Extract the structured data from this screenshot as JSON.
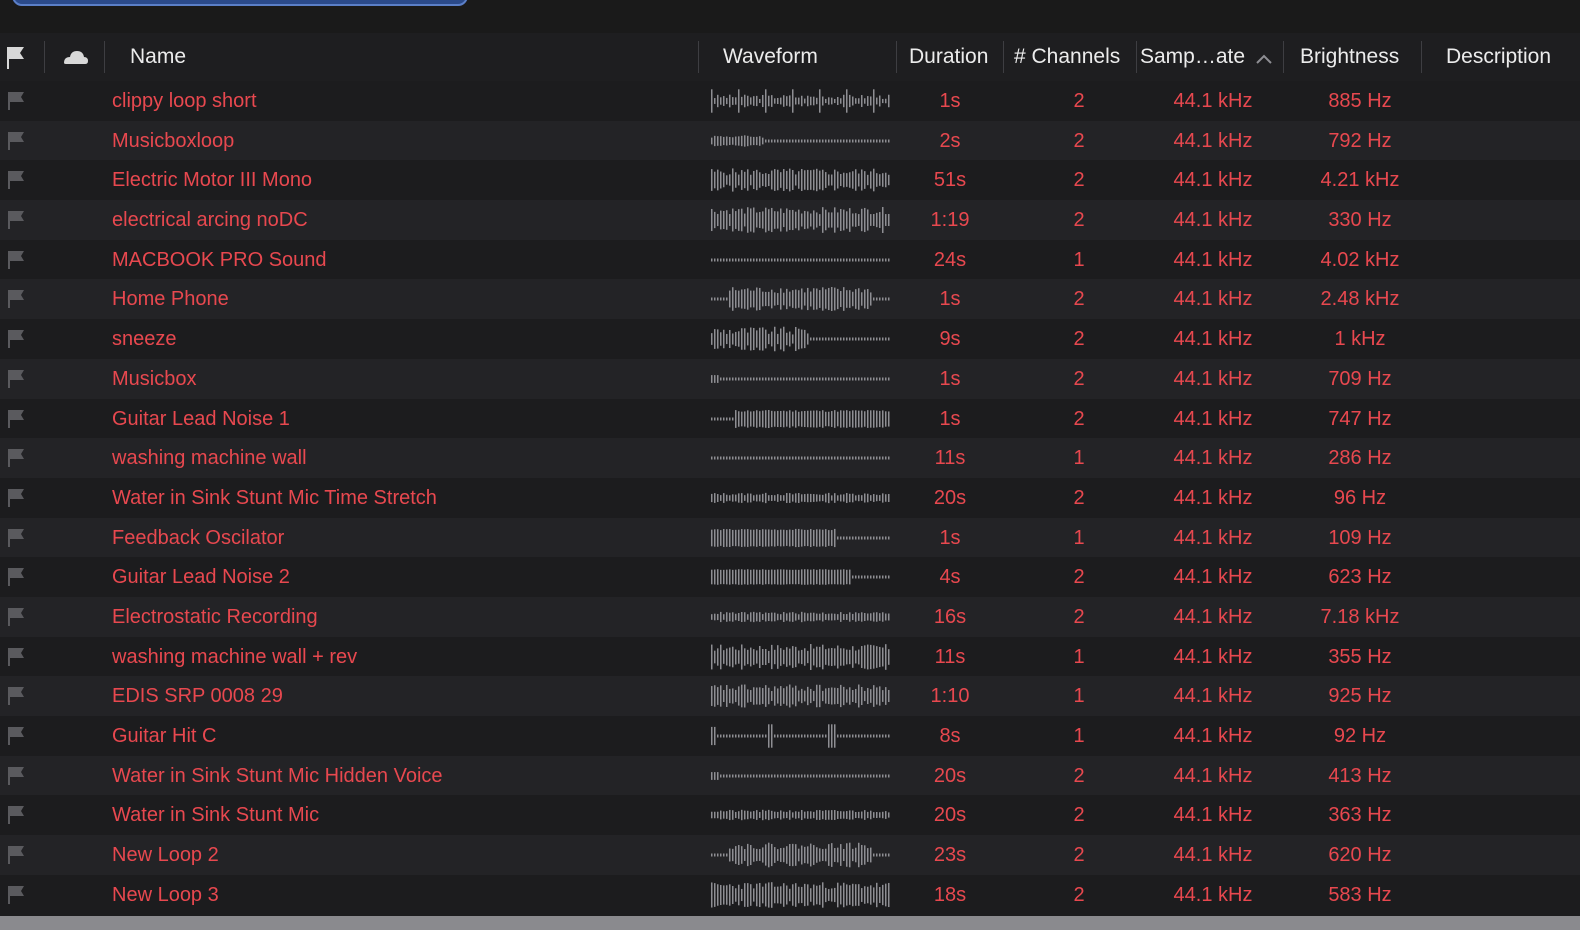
{
  "header": {
    "name": "Name",
    "waveform": "Waveform",
    "duration": "Duration",
    "channels": "# Channels",
    "sample_rate": "Samp…ate",
    "brightness": "Brightness",
    "description": "Description"
  },
  "colors": {
    "row_text": "#e8484f",
    "header_text": "#ececec",
    "waveform": "#8e8e93"
  },
  "rows": [
    {
      "name": "clippy loop short",
      "duration": "1s",
      "channels": "2",
      "sample_rate": "44.1 kHz",
      "brightness": "885 Hz",
      "wave": "spikes"
    },
    {
      "name": "Musicboxloop",
      "duration": "2s",
      "channels": "2",
      "sample_rate": "44.1 kHz",
      "brightness": "792 Hz",
      "wave": "low-front"
    },
    {
      "name": "Electric Motor III  Mono",
      "duration": "51s",
      "channels": "2",
      "sample_rate": "44.1 kHz",
      "brightness": "4.21 kHz",
      "wave": "dense-mid"
    },
    {
      "name": "electrical arcing noDC",
      "duration": "1:19",
      "channels": "2",
      "sample_rate": "44.1 kHz",
      "brightness": "330 Hz",
      "wave": "dense-high"
    },
    {
      "name": "MACBOOK PRO Sound",
      "duration": "24s",
      "channels": "1",
      "sample_rate": "44.1 kHz",
      "brightness": "4.02 kHz",
      "wave": "flat"
    },
    {
      "name": "Home Phone",
      "duration": "1s",
      "channels": "2",
      "sample_rate": "44.1 kHz",
      "brightness": "2.48 kHz",
      "wave": "mid-burst"
    },
    {
      "name": "sneeze",
      "duration": "9s",
      "channels": "2",
      "sample_rate": "44.1 kHz",
      "brightness": "1 kHz",
      "wave": "front-burst"
    },
    {
      "name": "Musicbox",
      "duration": "1s",
      "channels": "2",
      "sample_rate": "44.1 kHz",
      "brightness": "709 Hz",
      "wave": "flat-low"
    },
    {
      "name": "Guitar Lead Noise 1",
      "duration": "1s",
      "channels": "2",
      "sample_rate": "44.1 kHz",
      "brightness": "747 Hz",
      "wave": "ramp-up"
    },
    {
      "name": "washing machine  wall",
      "duration": "11s",
      "channels": "1",
      "sample_rate": "44.1 kHz",
      "brightness": "286 Hz",
      "wave": "flat"
    },
    {
      "name": "Water in Sink Stunt Mic  Time Stretch",
      "duration": "20s",
      "channels": "2",
      "sample_rate": "44.1 kHz",
      "brightness": "96 Hz",
      "wave": "low-steady"
    },
    {
      "name": "Feedback Oscilator",
      "duration": "1s",
      "channels": "1",
      "sample_rate": "44.1 kHz",
      "brightness": "109 Hz",
      "wave": "front-block"
    },
    {
      "name": "Guitar Lead Noise 2",
      "duration": "4s",
      "channels": "2",
      "sample_rate": "44.1 kHz",
      "brightness": "623 Hz",
      "wave": "block-fade"
    },
    {
      "name": "Electrostatic Recording",
      "duration": "16s",
      "channels": "2",
      "sample_rate": "44.1 kHz",
      "brightness": "7.18 kHz",
      "wave": "low-steady"
    },
    {
      "name": "washing machine  wall + rev",
      "duration": "11s",
      "channels": "1",
      "sample_rate": "44.1 kHz",
      "brightness": "355 Hz",
      "wave": "dense-high"
    },
    {
      "name": "EDIS SRP 0008 29",
      "duration": "1:10",
      "channels": "1",
      "sample_rate": "44.1 kHz",
      "brightness": "925 Hz",
      "wave": "dense-mid"
    },
    {
      "name": "Guitar Hit C",
      "duration": "8s",
      "channels": "1",
      "sample_rate": "44.1 kHz",
      "brightness": "92 Hz",
      "wave": "two-spikes"
    },
    {
      "name": "Water in Sink Stunt Mic  Hidden Voice",
      "duration": "20s",
      "channels": "2",
      "sample_rate": "44.1 kHz",
      "brightness": "413 Hz",
      "wave": "flat-low"
    },
    {
      "name": "Water in Sink Stunt Mic",
      "duration": "20s",
      "channels": "2",
      "sample_rate": "44.1 kHz",
      "brightness": "363 Hz",
      "wave": "low-steady"
    },
    {
      "name": "New Loop 2",
      "duration": "23s",
      "channels": "2",
      "sample_rate": "44.1 kHz",
      "brightness": "620 Hz",
      "wave": "mid-burst"
    },
    {
      "name": "New Loop 3",
      "duration": "18s",
      "channels": "2",
      "sample_rate": "44.1 kHz",
      "brightness": "583 Hz",
      "wave": "dense-high"
    }
  ]
}
